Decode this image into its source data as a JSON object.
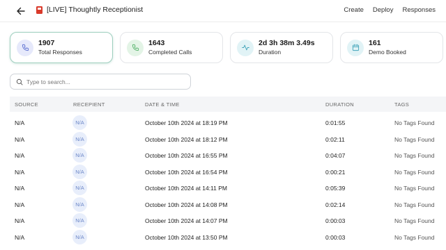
{
  "header": {
    "title": "[LIVE] Thoughtly Receptionist",
    "nav": [
      "Create",
      "Deploy",
      "Responses"
    ]
  },
  "stats": [
    {
      "value": "1907",
      "label": "Total Responses",
      "icon": "phone-icon",
      "color": "#7b8fe0",
      "bg": "#e6e9fb"
    },
    {
      "value": "1643",
      "label": "Completed Calls",
      "icon": "phone-check-icon",
      "color": "#57b36c",
      "bg": "#e3f4e6"
    },
    {
      "value": "2d 3h 38m 3.49s",
      "label": "Duration",
      "icon": "activity-icon",
      "color": "#3fa3b8",
      "bg": "#e1f3f6"
    },
    {
      "value": "161",
      "label": "Demo Booked",
      "icon": "calendar-icon",
      "color": "#3fa3b8",
      "bg": "#e1f3f6"
    }
  ],
  "search": {
    "placeholder": "Type to search..."
  },
  "table": {
    "columns": [
      "SOURCE",
      "RECEPIENT",
      "DATE & TIME",
      "DURATION",
      "TAGS"
    ],
    "rows": [
      {
        "source": "N/A",
        "recipient": "N/A",
        "datetime": "October 10th 2024 at 18:19 PM",
        "duration": "0:01:55",
        "tags": "No Tags Found"
      },
      {
        "source": "N/A",
        "recipient": "N/A",
        "datetime": "October 10th 2024 at 18:12 PM",
        "duration": "0:02:11",
        "tags": "No Tags Found"
      },
      {
        "source": "N/A",
        "recipient": "N/A",
        "datetime": "October 10th 2024 at 16:55 PM",
        "duration": "0:04:07",
        "tags": "No Tags Found"
      },
      {
        "source": "N/A",
        "recipient": "N/A",
        "datetime": "October 10th 2024 at 16:54 PM",
        "duration": "0:00:21",
        "tags": "No Tags Found"
      },
      {
        "source": "N/A",
        "recipient": "N/A",
        "datetime": "October 10th 2024 at 14:11 PM",
        "duration": "0:05:39",
        "tags": "No Tags Found"
      },
      {
        "source": "N/A",
        "recipient": "N/A",
        "datetime": "October 10th 2024 at 14:08 PM",
        "duration": "0:02:14",
        "tags": "No Tags Found"
      },
      {
        "source": "N/A",
        "recipient": "N/A",
        "datetime": "October 10th 2024 at 14:07 PM",
        "duration": "0:00:03",
        "tags": "No Tags Found"
      },
      {
        "source": "N/A",
        "recipient": "N/A",
        "datetime": "October 10th 2024 at 13:50 PM",
        "duration": "0:00:03",
        "tags": "No Tags Found"
      }
    ]
  }
}
